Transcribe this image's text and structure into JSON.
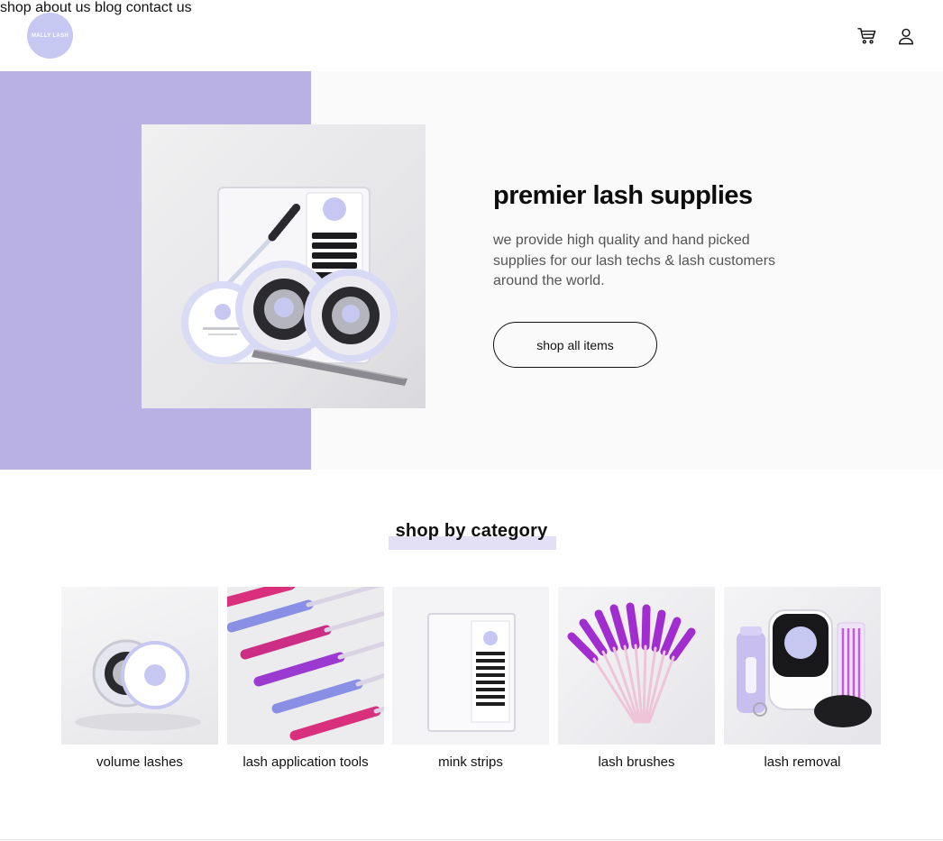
{
  "header": {
    "logo_text": "MALLY LASH",
    "nav": [
      {
        "label": "shop"
      },
      {
        "label": "about us"
      },
      {
        "label": "blog"
      },
      {
        "label": "contact us"
      }
    ],
    "icons": [
      "cart-icon",
      "user-icon"
    ]
  },
  "hero": {
    "title": "premier lash supplies",
    "description": "we provide high quality and hand picked supplies for our lash techs & lash customers around the world.",
    "cta_label": "shop all items",
    "accent_color": "#b9b1e4"
  },
  "categories": {
    "title": "shop by category",
    "items": [
      {
        "label": "volume lashes"
      },
      {
        "label": "lash application tools"
      },
      {
        "label": "mink strips"
      },
      {
        "label": "lash brushes"
      },
      {
        "label": "lash removal"
      }
    ]
  }
}
